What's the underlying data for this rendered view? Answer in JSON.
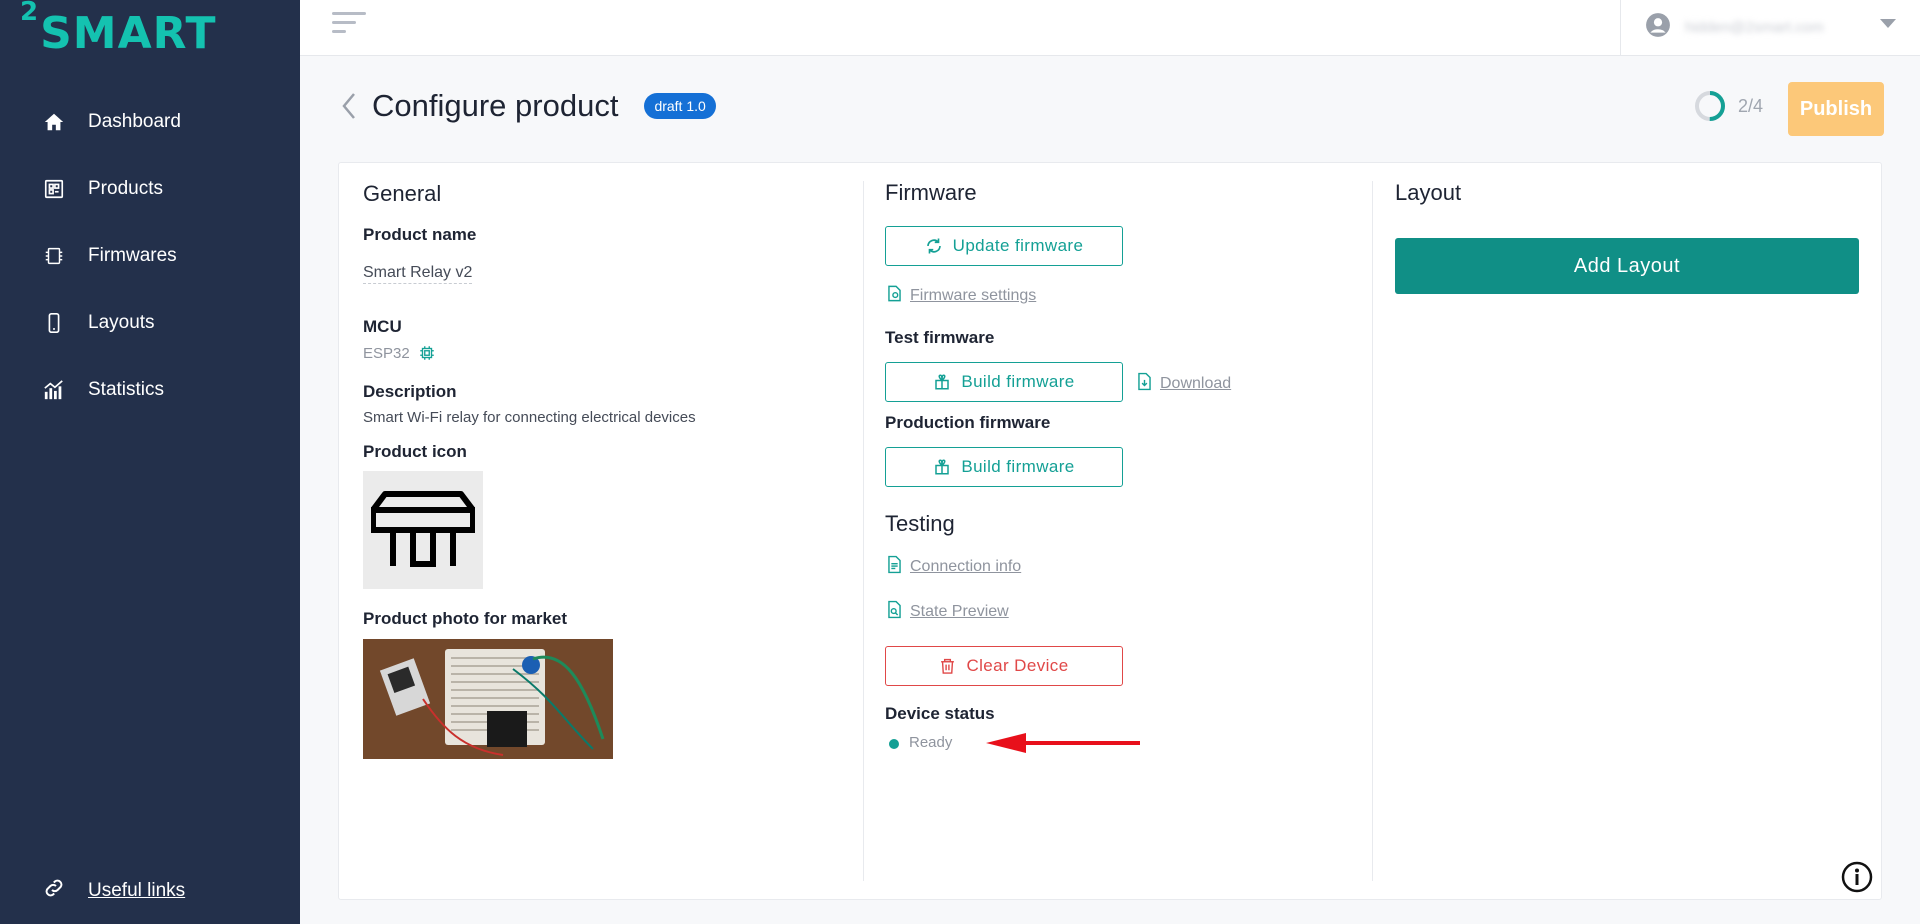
{
  "brand": {
    "logo_sup": "2",
    "logo_text": "SMART",
    "accent": "#14c2b0",
    "sidebar_bg": "#23304b"
  },
  "sidebar": {
    "items": [
      {
        "label": "Dashboard",
        "icon": "home-icon"
      },
      {
        "label": "Products",
        "icon": "products-icon"
      },
      {
        "label": "Firmwares",
        "icon": "chip-icon"
      },
      {
        "label": "Layouts",
        "icon": "phone-icon"
      },
      {
        "label": "Statistics",
        "icon": "statistics-icon"
      }
    ],
    "useful_links": "Useful links"
  },
  "topbar": {
    "user_email": "hidden@2smart.com",
    "user_icon": "account-icon"
  },
  "header": {
    "title": "Configure product",
    "badge": "draft 1.0",
    "progress_text": "2/4",
    "progress_fraction": 0.5,
    "publish_label": "Publish"
  },
  "general": {
    "title": "General",
    "product_name_label": "Product name",
    "product_name": "Smart Relay v2",
    "mcu_label": "MCU",
    "mcu_value": "ESP32",
    "description_label": "Description",
    "description": "Smart Wi-Fi relay for connecting electrical devices",
    "icon_label": "Product icon",
    "photo_label": "Product photo for market"
  },
  "firmware": {
    "title": "Firmware",
    "update_button": "Update firmware",
    "settings_link": "Firmware settings",
    "test_label": "Test firmware",
    "build_button": "Build firmware",
    "download_link": "Download",
    "production_label": "Production firmware",
    "build_button_production": "Build firmware",
    "testing_title": "Testing",
    "connection_info_link": "Connection info",
    "state_preview_link": "State Preview",
    "clear_device_button": "Clear Device",
    "device_status_label": "Device status",
    "device_status_value": "Ready"
  },
  "layout": {
    "title": "Layout",
    "add_button": "Add Layout"
  }
}
